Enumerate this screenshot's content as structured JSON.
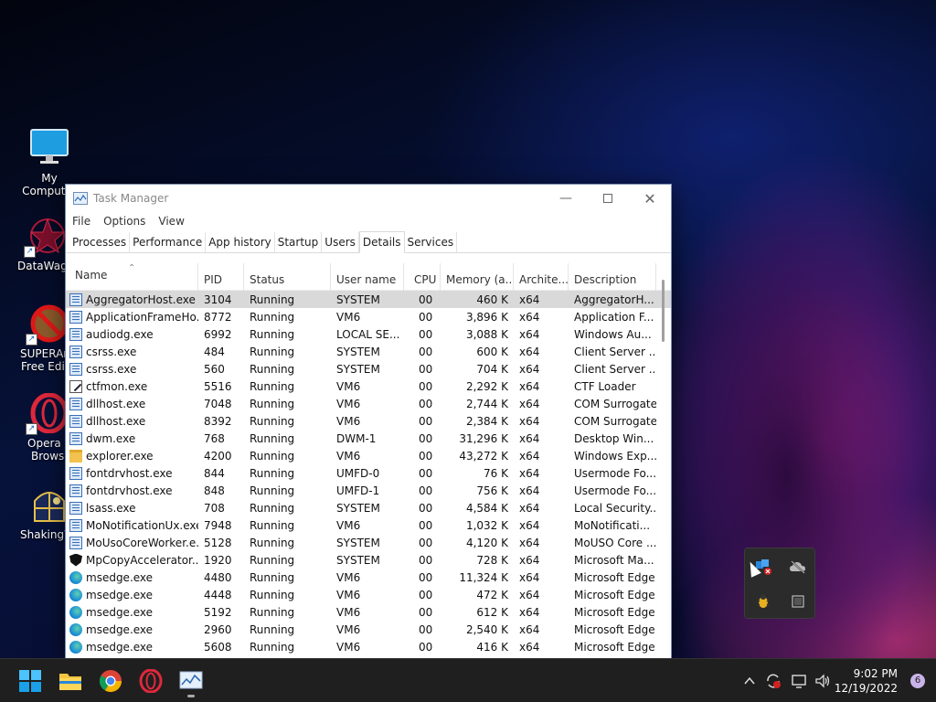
{
  "desktop": {
    "icons": [
      {
        "label": "My Computer",
        "icon": "monitor-icon"
      },
      {
        "label": "DataWago",
        "icon": "datawago-icon"
      },
      {
        "label": "SUPERAn",
        "label2": "Free Editi",
        "icon": "superantispyware-icon"
      },
      {
        "label": "Opera G",
        "label2": "Browse",
        "icon": "opera-gx-icon"
      },
      {
        "label": "ShakingW",
        "icon": "shaking-window-icon"
      }
    ]
  },
  "task_manager": {
    "title": "Task Manager",
    "menu": [
      "File",
      "Options",
      "View"
    ],
    "tabs": [
      "Processes",
      "Performance",
      "App history",
      "Startup",
      "Users",
      "Details",
      "Services"
    ],
    "active_tab": "Details",
    "columns": [
      "Name",
      "PID",
      "Status",
      "User name",
      "CPU",
      "Memory (a...",
      "Archite...",
      "Description"
    ],
    "sort_column": "Name",
    "rows": [
      {
        "icon": "window",
        "name": "AggregatorHost.exe",
        "pid": "3104",
        "status": "Running",
        "user": "SYSTEM",
        "cpu": "00",
        "mem": "460 K",
        "arch": "x64",
        "desc": "AggregatorH..."
      },
      {
        "icon": "window",
        "name": "ApplicationFrameHo...",
        "pid": "8772",
        "status": "Running",
        "user": "VM6",
        "cpu": "00",
        "mem": "3,896 K",
        "arch": "x64",
        "desc": "Application F..."
      },
      {
        "icon": "window",
        "name": "audiodg.exe",
        "pid": "6992",
        "status": "Running",
        "user": "LOCAL SE...",
        "cpu": "00",
        "mem": "3,088 K",
        "arch": "x64",
        "desc": "Windows Au..."
      },
      {
        "icon": "window",
        "name": "csrss.exe",
        "pid": "484",
        "status": "Running",
        "user": "SYSTEM",
        "cpu": "00",
        "mem": "600 K",
        "arch": "x64",
        "desc": "Client Server ..."
      },
      {
        "icon": "window",
        "name": "csrss.exe",
        "pid": "560",
        "status": "Running",
        "user": "SYSTEM",
        "cpu": "00",
        "mem": "704 K",
        "arch": "x64",
        "desc": "Client Server ..."
      },
      {
        "icon": "pen",
        "name": "ctfmon.exe",
        "pid": "5516",
        "status": "Running",
        "user": "VM6",
        "cpu": "00",
        "mem": "2,292 K",
        "arch": "x64",
        "desc": "CTF Loader"
      },
      {
        "icon": "window",
        "name": "dllhost.exe",
        "pid": "7048",
        "status": "Running",
        "user": "VM6",
        "cpu": "00",
        "mem": "2,744 K",
        "arch": "x64",
        "desc": "COM Surrogate"
      },
      {
        "icon": "window",
        "name": "dllhost.exe",
        "pid": "8392",
        "status": "Running",
        "user": "VM6",
        "cpu": "00",
        "mem": "2,384 K",
        "arch": "x64",
        "desc": "COM Surrogate"
      },
      {
        "icon": "window",
        "name": "dwm.exe",
        "pid": "768",
        "status": "Running",
        "user": "DWM-1",
        "cpu": "00",
        "mem": "31,296 K",
        "arch": "x64",
        "desc": "Desktop Win..."
      },
      {
        "icon": "folder",
        "name": "explorer.exe",
        "pid": "4200",
        "status": "Running",
        "user": "VM6",
        "cpu": "00",
        "mem": "43,272 K",
        "arch": "x64",
        "desc": "Windows Exp..."
      },
      {
        "icon": "window",
        "name": "fontdrvhost.exe",
        "pid": "844",
        "status": "Running",
        "user": "UMFD-0",
        "cpu": "00",
        "mem": "76 K",
        "arch": "x64",
        "desc": "Usermode Fo..."
      },
      {
        "icon": "window",
        "name": "fontdrvhost.exe",
        "pid": "848",
        "status": "Running",
        "user": "UMFD-1",
        "cpu": "00",
        "mem": "756 K",
        "arch": "x64",
        "desc": "Usermode Fo..."
      },
      {
        "icon": "window",
        "name": "lsass.exe",
        "pid": "708",
        "status": "Running",
        "user": "SYSTEM",
        "cpu": "00",
        "mem": "4,584 K",
        "arch": "x64",
        "desc": "Local Security..."
      },
      {
        "icon": "window",
        "name": "MoNotificationUx.exe",
        "pid": "7948",
        "status": "Running",
        "user": "VM6",
        "cpu": "00",
        "mem": "1,032 K",
        "arch": "x64",
        "desc": "MoNotificati..."
      },
      {
        "icon": "window",
        "name": "MoUsoCoreWorker.e...",
        "pid": "5128",
        "status": "Running",
        "user": "SYSTEM",
        "cpu": "00",
        "mem": "4,120 K",
        "arch": "x64",
        "desc": "MoUSO Core ..."
      },
      {
        "icon": "shield",
        "name": "MpCopyAccelerator....",
        "pid": "1920",
        "status": "Running",
        "user": "SYSTEM",
        "cpu": "00",
        "mem": "728 K",
        "arch": "x64",
        "desc": "Microsoft Ma..."
      },
      {
        "icon": "edge",
        "name": "msedge.exe",
        "pid": "4480",
        "status": "Running",
        "user": "VM6",
        "cpu": "00",
        "mem": "11,324 K",
        "arch": "x64",
        "desc": "Microsoft Edge"
      },
      {
        "icon": "edge",
        "name": "msedge.exe",
        "pid": "4448",
        "status": "Running",
        "user": "VM6",
        "cpu": "00",
        "mem": "472 K",
        "arch": "x64",
        "desc": "Microsoft Edge"
      },
      {
        "icon": "edge",
        "name": "msedge.exe",
        "pid": "5192",
        "status": "Running",
        "user": "VM6",
        "cpu": "00",
        "mem": "612 K",
        "arch": "x64",
        "desc": "Microsoft Edge"
      },
      {
        "icon": "edge",
        "name": "msedge.exe",
        "pid": "2960",
        "status": "Running",
        "user": "VM6",
        "cpu": "00",
        "mem": "2,540 K",
        "arch": "x64",
        "desc": "Microsoft Edge"
      },
      {
        "icon": "edge",
        "name": "msedge.exe",
        "pid": "5608",
        "status": "Running",
        "user": "VM6",
        "cpu": "00",
        "mem": "416 K",
        "arch": "x64",
        "desc": "Microsoft Edge"
      }
    ]
  },
  "taskbar": {
    "pinned": [
      "start-icon",
      "file-explorer-icon",
      "chrome-icon",
      "opera-icon",
      "task-manager-icon"
    ],
    "clock_time": "9:02 PM",
    "clock_date": "12/19/2022",
    "notification_count": "6"
  },
  "tray_popup": {
    "items": [
      "defender-warning-icon",
      "onedrive-offline-icon",
      "bug-icon",
      "app-tray-icon"
    ]
  },
  "colors": {
    "accent": "#0078d4",
    "selected_row": "#d9d9d9",
    "taskbar": "#1f1f1f"
  }
}
